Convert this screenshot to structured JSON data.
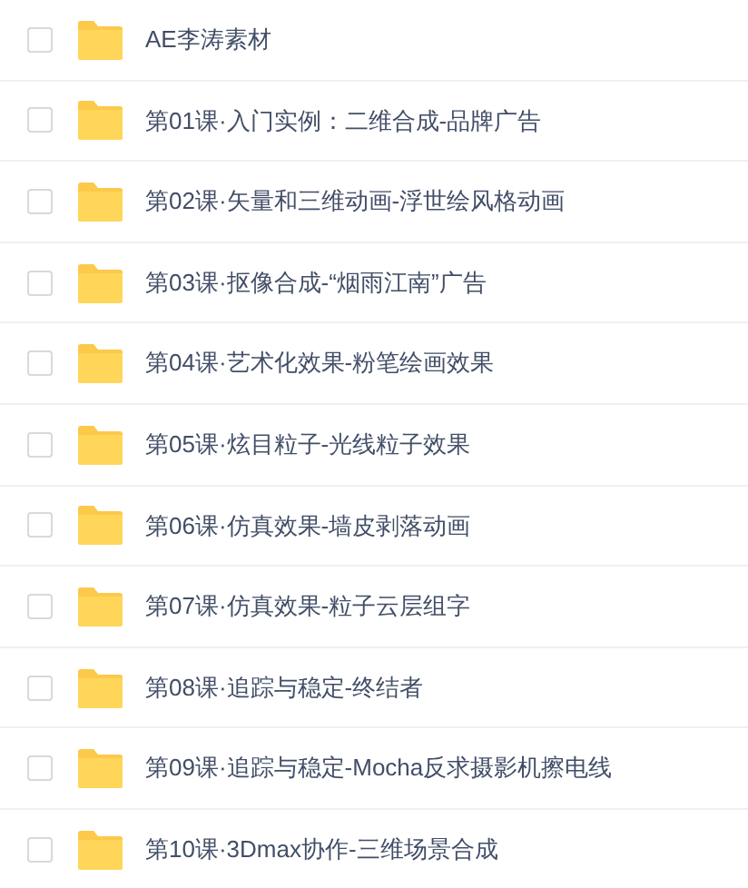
{
  "items": [
    {
      "name": "AE李涛素材",
      "checked": false
    },
    {
      "name": "第01课·入门实例：二维合成-品牌广告",
      "checked": false
    },
    {
      "name": "第02课·矢量和三维动画-浮世绘风格动画",
      "checked": false
    },
    {
      "name": "第03课·抠像合成-“烟雨江南”广告",
      "checked": false
    },
    {
      "name": "第04课·艺术化效果-粉笔绘画效果",
      "checked": false
    },
    {
      "name": "第05课·炫目粒子-光线粒子效果",
      "checked": false
    },
    {
      "name": "第06课·仿真效果-墙皮剥落动画",
      "checked": false
    },
    {
      "name": "第07课·仿真效果-粒子云层组字",
      "checked": false
    },
    {
      "name": "第08课·追踪与稳定-终结者",
      "checked": false
    },
    {
      "name": "第09课·追踪与稳定-Mocha反求摄影机擦电线",
      "checked": false
    },
    {
      "name": "第10课·3Dmax协作-三维场景合成",
      "checked": false
    }
  ]
}
